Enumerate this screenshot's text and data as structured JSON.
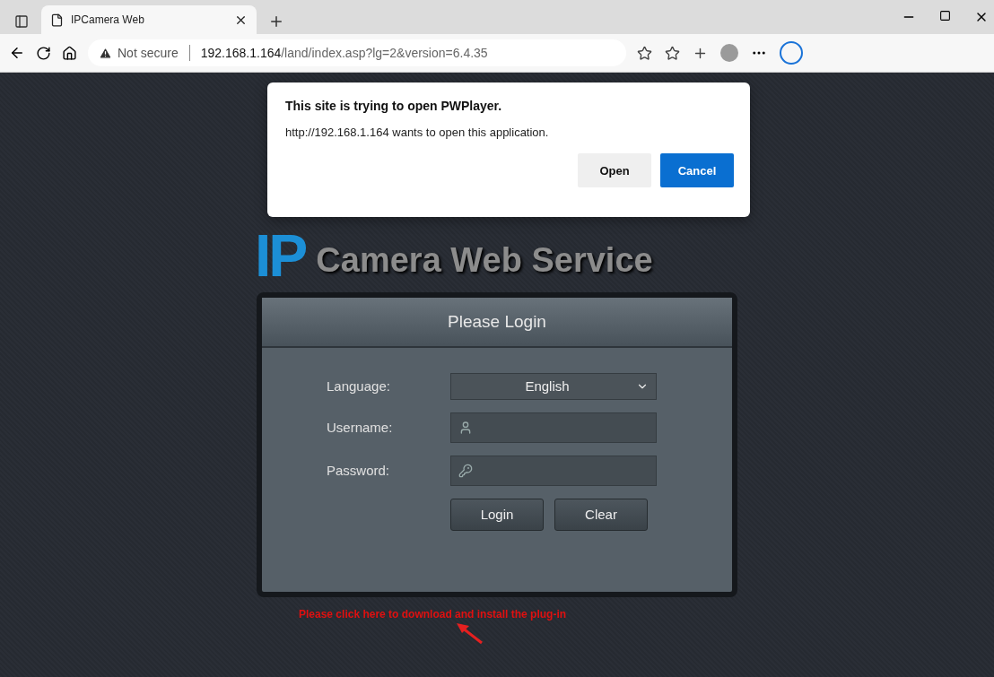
{
  "browser": {
    "tab": {
      "title": "IPCamera Web",
      "selected": true
    },
    "address": {
      "security": "Not secure",
      "host": "192.168.1.164",
      "path": "/land/index.asp?lg=2&version=6.4.35"
    }
  },
  "dialog": {
    "title": "This site is trying to open PWPlayer.",
    "message": "http://192.168.1.164 wants to open this application.",
    "buttons": [
      {
        "label": "Open",
        "kind": "secondary"
      },
      {
        "label": "Cancel",
        "kind": "primary"
      }
    ]
  },
  "logo": {
    "mark": "IP",
    "title": "Camera Web Service"
  },
  "login": {
    "title": "Please Login",
    "fields": [
      {
        "label": "Language:",
        "kind": "select",
        "value": "English"
      },
      {
        "label": "Username:",
        "kind": "user"
      },
      {
        "label": "Password:",
        "kind": "password"
      }
    ],
    "buttons": [
      "Login",
      "Clear"
    ]
  },
  "plugin_link": "Please click here to download and install the plug-in"
}
